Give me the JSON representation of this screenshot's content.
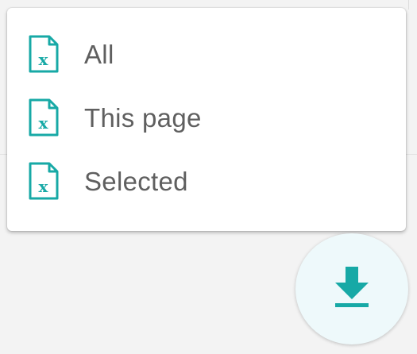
{
  "theme": {
    "accent": "#17a9a6",
    "label_color": "#5f5f5f",
    "fab_background": "#eef9fb"
  },
  "export_menu": {
    "items": [
      {
        "label": "All",
        "icon": "excel-file-icon"
      },
      {
        "label": "This page",
        "icon": "excel-file-icon"
      },
      {
        "label": "Selected",
        "icon": "excel-file-icon"
      }
    ]
  },
  "download_button": {
    "icon": "download-icon"
  }
}
